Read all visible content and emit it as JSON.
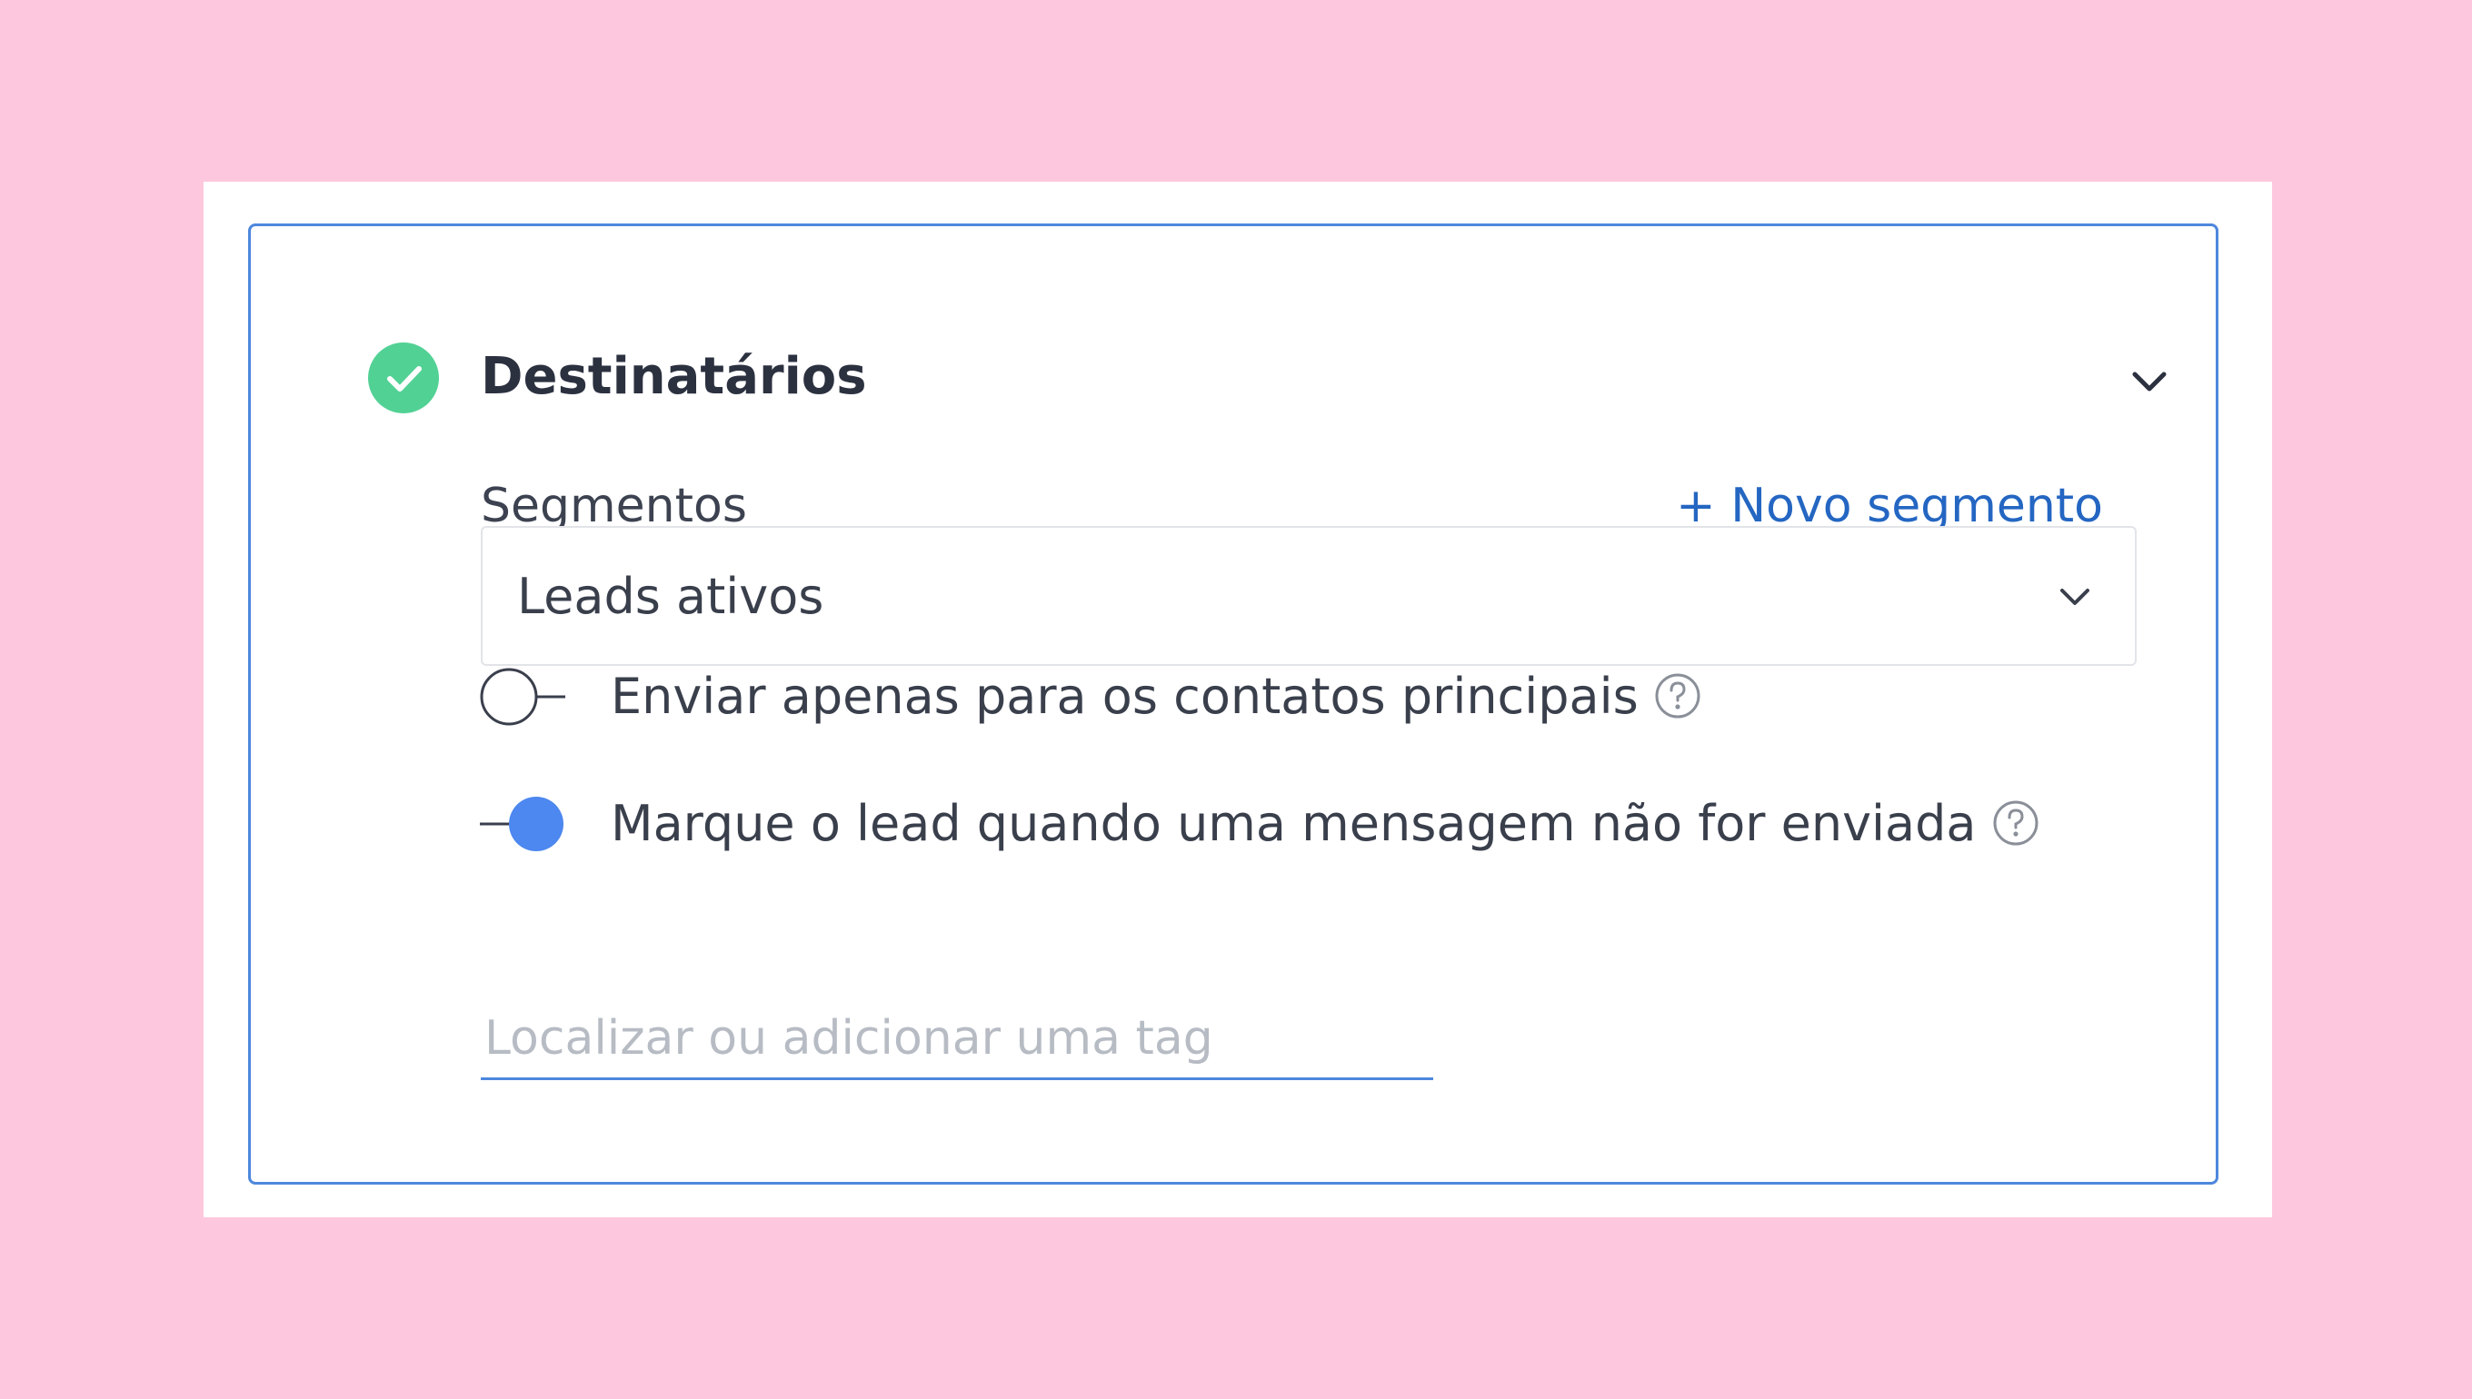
{
  "section": {
    "title": "Destinatários",
    "status_icon": "check-circle-icon",
    "collapse_icon": "chevron-down-icon"
  },
  "segments": {
    "label": "Segmentos",
    "new_segment_link": "+ Novo segmento",
    "selected_value": "Leads ativos",
    "dropdown_icon": "chevron-down-icon"
  },
  "options": [
    {
      "label": "Enviar apenas para os contatos principais",
      "enabled": false,
      "help_icon": "question-circle-icon"
    },
    {
      "label": "Marque o lead quando uma mensagem não for enviada",
      "enabled": true,
      "help_icon": "question-circle-icon"
    }
  ],
  "tag_input": {
    "value": "",
    "placeholder": "Localizar ou adicionar uma tag"
  },
  "colors": {
    "background": "#fdc8de",
    "card_border": "#4d87dd",
    "success": "#52d195",
    "link": "#2466c2",
    "toggle_on": "#4d87f0",
    "text": "#3a3f4c",
    "placeholder": "#b7bcc4"
  }
}
